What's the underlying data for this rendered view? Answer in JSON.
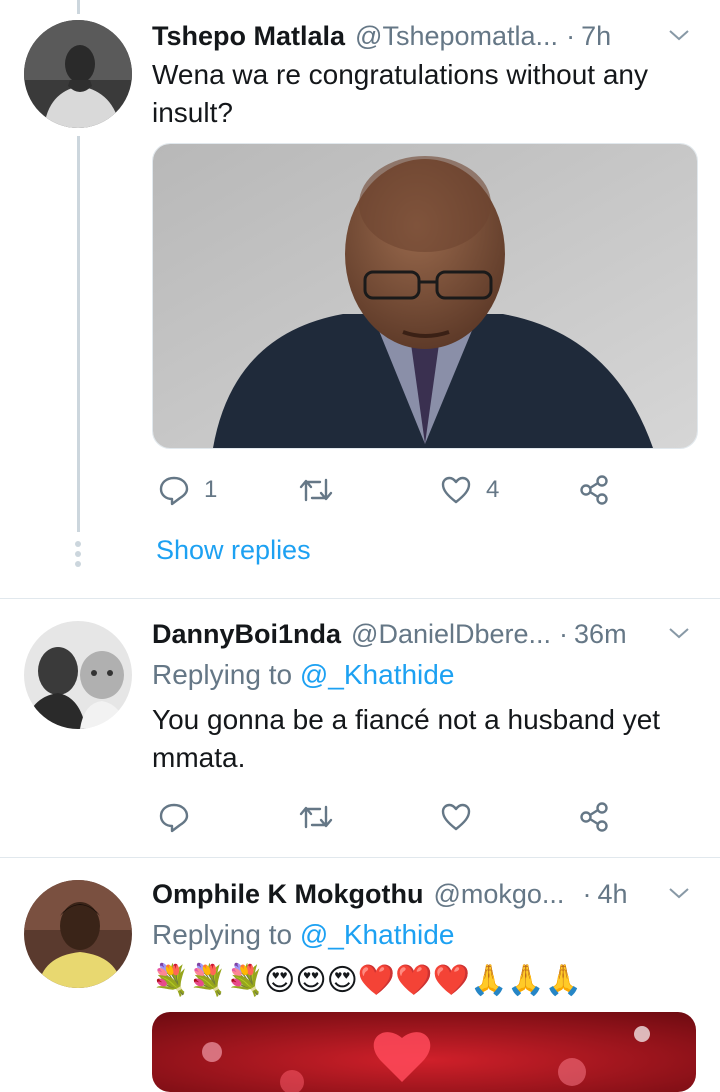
{
  "tweets": [
    {
      "name": "Tshepo Matlala",
      "handle": "@Tshepomatla...",
      "dot": "·",
      "time": "7h",
      "text": "Wena wa re congratulations without any insult?",
      "reply_count": "1",
      "retweet_count": "",
      "like_count": "4",
      "show_replies": "Show replies"
    },
    {
      "name": "DannyBoi1nda",
      "handle": "@DanielDbere...",
      "dot": "·",
      "time": "36m",
      "replying_prefix": "Replying to ",
      "replying_to": "@_Khathide",
      "text": "You gonna be a fiancé not a husband yet mmata."
    },
    {
      "name": "Omphile K Mokgothu",
      "handle": "@mokgo...",
      "dot": "·",
      "time": "4h",
      "replying_prefix": "Replying to ",
      "replying_to": "@_Khathide",
      "text": "💐💐💐😍😍😍❤️❤️❤️🙏🙏🙏"
    }
  ],
  "colors": {
    "accent": "#1da1f2",
    "secondary_text": "#657786",
    "divider": "#e1e8ed"
  }
}
